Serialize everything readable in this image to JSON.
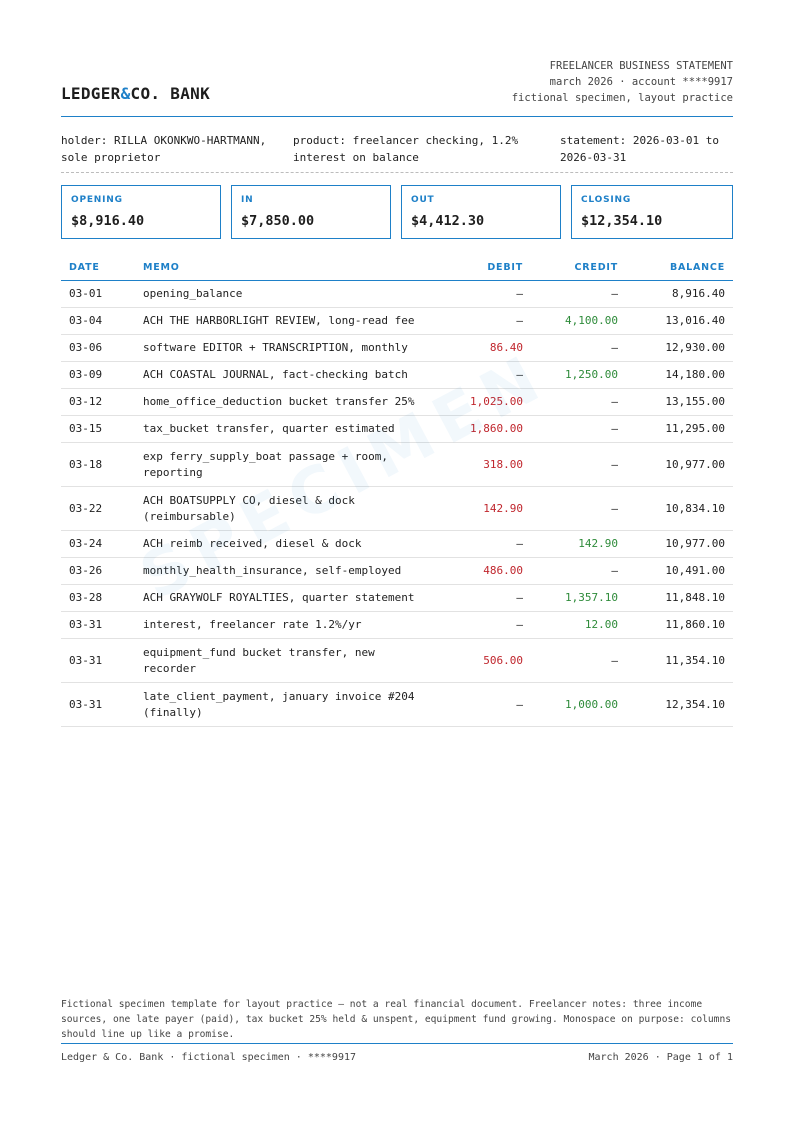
{
  "header": {
    "brand_prefix": "LEDGER",
    "brand_amp": "&",
    "brand_suffix": "CO. BANK",
    "doc_title": "FREELANCER BUSINESS STATEMENT",
    "period_account": "march 2026 · account ****9917",
    "specimen_note": "fictional specimen, layout practice"
  },
  "info": {
    "holder": "holder: RILLA OKONKWO-HARTMANN, sole proprietor",
    "product": "product: freelancer checking, 1.2% interest on balance",
    "statement": "statement: 2026-03-01 to 2026-03-31"
  },
  "summary": [
    {
      "label": "OPENING",
      "value": "$8,916.40"
    },
    {
      "label": "IN",
      "value": "$7,850.00"
    },
    {
      "label": "OUT",
      "value": "$4,412.30"
    },
    {
      "label": "CLOSING",
      "value": "$12,354.10"
    }
  ],
  "table": {
    "headers": {
      "date": "DATE",
      "memo": "MEMO",
      "debit": "DEBIT",
      "credit": "CREDIT",
      "balance": "BALANCE"
    },
    "rows": [
      {
        "date": "03-01",
        "memo": "opening_balance",
        "debit": "—",
        "credit": "—",
        "balance": "8,916.40"
      },
      {
        "date": "03-04",
        "memo": "ACH THE HARBORLIGHT REVIEW, long-read fee",
        "debit": "—",
        "credit": "4,100.00",
        "balance": "13,016.40"
      },
      {
        "date": "03-06",
        "memo": "software EDITOR + TRANSCRIPTION, monthly",
        "debit": "86.40",
        "credit": "—",
        "balance": "12,930.00"
      },
      {
        "date": "03-09",
        "memo": "ACH COASTAL JOURNAL, fact-checking batch",
        "debit": "—",
        "credit": "1,250.00",
        "balance": "14,180.00"
      },
      {
        "date": "03-12",
        "memo": "home_office_deduction bucket transfer 25%",
        "debit": "1,025.00",
        "credit": "—",
        "balance": "13,155.00"
      },
      {
        "date": "03-15",
        "memo": "tax_bucket transfer, quarter estimated",
        "debit": "1,860.00",
        "credit": "—",
        "balance": "11,295.00"
      },
      {
        "date": "03-18",
        "memo": "exp ferry_supply_boat passage + room, reporting",
        "debit": "318.00",
        "credit": "—",
        "balance": "10,977.00"
      },
      {
        "date": "03-22",
        "memo": "ACH BOATSUPPLY CO, diesel & dock (reimbursable)",
        "debit": "142.90",
        "credit": "—",
        "balance": "10,834.10"
      },
      {
        "date": "03-24",
        "memo": "ACH reimb received, diesel & dock",
        "debit": "—",
        "credit": "142.90",
        "balance": "10,977.00"
      },
      {
        "date": "03-26",
        "memo": "monthly_health_insurance, self-employed",
        "debit": "486.00",
        "credit": "—",
        "balance": "10,491.00"
      },
      {
        "date": "03-28",
        "memo": "ACH GRAYWOLF ROYALTIES, quarter statement",
        "debit": "—",
        "credit": "1,357.10",
        "balance": "11,848.10"
      },
      {
        "date": "03-31",
        "memo": "interest, freelancer rate 1.2%/yr",
        "debit": "—",
        "credit": "12.00",
        "balance": "11,860.10"
      },
      {
        "date": "03-31",
        "memo": "equipment_fund bucket transfer, new recorder",
        "debit": "506.00",
        "credit": "—",
        "balance": "11,354.10"
      },
      {
        "date": "03-31",
        "memo": "late_client_payment, january invoice #204 (finally)",
        "debit": "—",
        "credit": "1,000.00",
        "balance": "12,354.10"
      }
    ]
  },
  "watermark": "SPECIMEN",
  "footer": {
    "note": "Fictional specimen template for layout practice — not a real financial document. Freelancer notes: three income sources, one late payer (paid), tax bucket 25% held & unspent, equipment fund growing. Monospace on purpose: columns should line up like a promise.",
    "left": "Ledger & Co. Bank · fictional specimen · ****9917",
    "right": "March 2026 · Page 1 of 1"
  },
  "colors": {
    "accent": "#1e80c8",
    "debit": "#c0262d",
    "credit": "#2e8b3a"
  }
}
